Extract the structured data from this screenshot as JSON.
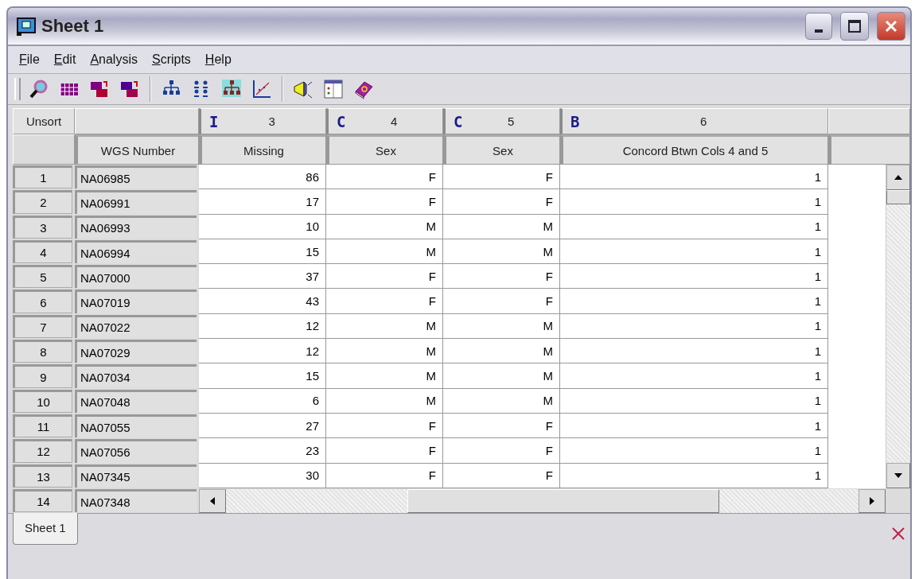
{
  "window": {
    "title": "Sheet 1"
  },
  "menu": [
    "File",
    "Edit",
    "Analysis",
    "Scripts",
    "Help"
  ],
  "grid": {
    "corner_label": "Unsort",
    "columns": [
      {
        "name": "WGS Number"
      },
      {
        "type_glyph": "I",
        "number": "3",
        "name": "Missing"
      },
      {
        "type_glyph": "C",
        "number": "4",
        "name": "Sex"
      },
      {
        "type_glyph": "C",
        "number": "5",
        "name": "Sex"
      },
      {
        "type_glyph": "B",
        "number": "6",
        "name": "Concord Btwn Cols 4 and 5"
      }
    ],
    "rows": [
      {
        "number": "1",
        "id": "NA06985",
        "cells": [
          "86",
          "F",
          "F",
          "1"
        ]
      },
      {
        "number": "2",
        "id": "NA06991",
        "cells": [
          "17",
          "F",
          "F",
          "1"
        ]
      },
      {
        "number": "3",
        "id": "NA06993",
        "cells": [
          "10",
          "M",
          "M",
          "1"
        ]
      },
      {
        "number": "4",
        "id": "NA06994",
        "cells": [
          "15",
          "M",
          "M",
          "1"
        ]
      },
      {
        "number": "5",
        "id": "NA07000",
        "cells": [
          "37",
          "F",
          "F",
          "1"
        ]
      },
      {
        "number": "6",
        "id": "NA07019",
        "cells": [
          "43",
          "F",
          "F",
          "1"
        ]
      },
      {
        "number": "7",
        "id": "NA07022",
        "cells": [
          "12",
          "M",
          "M",
          "1"
        ]
      },
      {
        "number": "8",
        "id": "NA07029",
        "cells": [
          "12",
          "M",
          "M",
          "1"
        ]
      },
      {
        "number": "9",
        "id": "NA07034",
        "cells": [
          "15",
          "M",
          "M",
          "1"
        ]
      },
      {
        "number": "10",
        "id": "NA07048",
        "cells": [
          "6",
          "M",
          "M",
          "1"
        ]
      },
      {
        "number": "11",
        "id": "NA07055",
        "cells": [
          "27",
          "F",
          "F",
          "1"
        ]
      },
      {
        "number": "12",
        "id": "NA07056",
        "cells": [
          "23",
          "F",
          "F",
          "1"
        ]
      },
      {
        "number": "13",
        "id": "NA07345",
        "cells": [
          "30",
          "F",
          "F",
          "1"
        ]
      },
      {
        "number": "14",
        "id": "NA07348"
      }
    ]
  },
  "tabs": [
    {
      "label": "Sheet 1",
      "selected": true
    }
  ]
}
